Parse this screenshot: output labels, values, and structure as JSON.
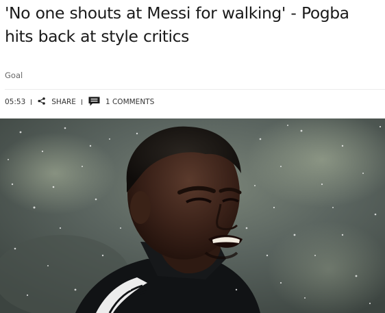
{
  "article": {
    "headline": "'No one shouts at Messi for walking' - Pogba hits back at style critics",
    "source": "Goal",
    "meta": {
      "time": "05:53",
      "share_label": "SHARE",
      "comments_label": "1 COMMENTS"
    },
    "hero_image": {
      "subject": "player in black training top in rain"
    }
  },
  "icons": {
    "share": "share-icon",
    "comments": "comment-icon"
  },
  "colors": {
    "headline": "#1a1a1a",
    "muted": "#666666",
    "meta": "#333333"
  }
}
